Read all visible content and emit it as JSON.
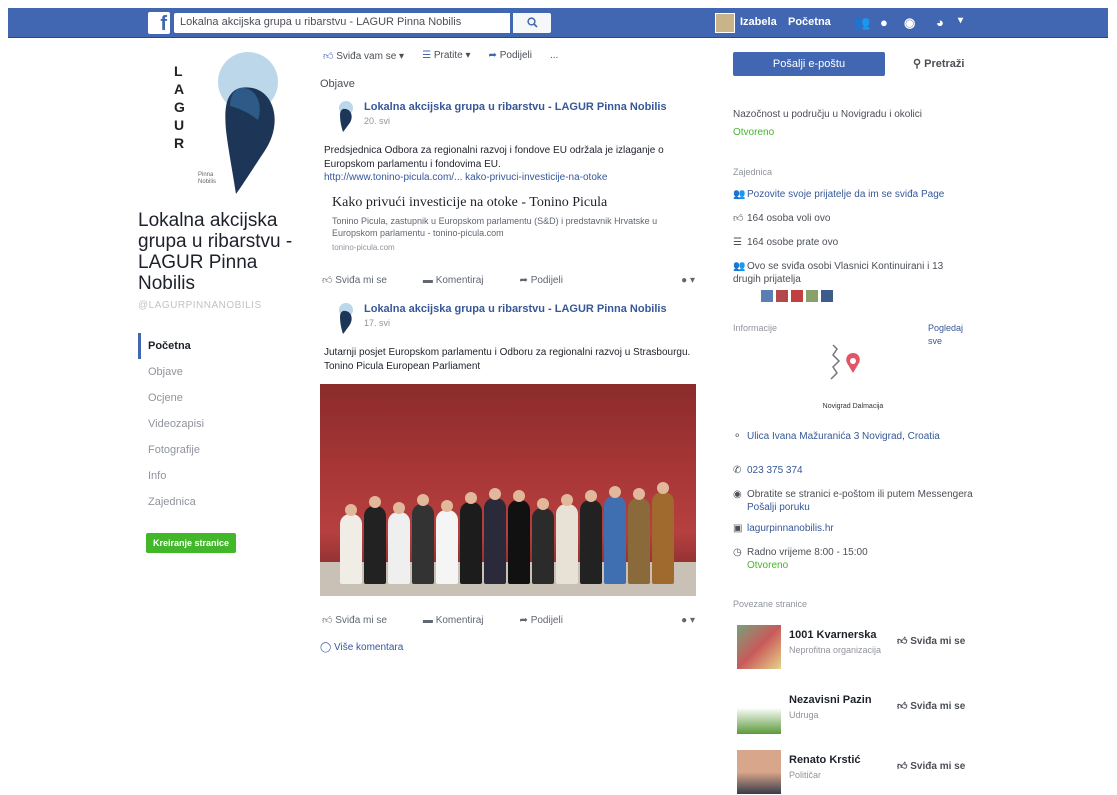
{
  "topbar": {
    "search_value": "Lokalna akcijska grupa u ribarstvu - LAGUR Pinna Nobilis",
    "user_name": "Izabela",
    "home_label": "Početna"
  },
  "left": {
    "logo_letters": [
      "L",
      "A",
      "G",
      "U",
      "R"
    ],
    "logo_caption": "Pinna Nobilis",
    "page_name": "Lokalna akcijska grupa u ribarstvu - LAGUR Pinna Nobilis",
    "handle": "@LAGURPINNANOBILIS",
    "nav": [
      {
        "label": "Početna",
        "active": true
      },
      {
        "label": "Objave"
      },
      {
        "label": "Ocjene"
      },
      {
        "label": "Videozapisi"
      },
      {
        "label": "Fotografije"
      },
      {
        "label": "Info"
      },
      {
        "label": "Zajednica"
      }
    ],
    "create_button": "Kreiranje stranice"
  },
  "middle": {
    "page_actions": [
      "Sviđa vam se",
      "Pratite",
      "Podijeli",
      "..."
    ],
    "section_title": "Objave",
    "posts": [
      {
        "author": "Lokalna akcijska grupa u ribarstvu - LAGUR Pinna Nobilis",
        "time": "20. svi",
        "text": "Predsjednica Odbora za regionalni razvoj i fondove EU održala je izlaganje o Europskom parlamentu i fondovima EU.",
        "link_url": "http://www.tonino-picula.com/... kako-privuci-investicije-na-otoke",
        "link_title": "Kako privući investicije na otoke - Tonino Picula",
        "link_desc": "Tonino Picula, zastupnik u Europskom parlamentu (S&D) i predstavnik Hrvatske u Europskom parlamentu - tonino-picula.com",
        "link_domain": "tonino-picula.com",
        "actions": [
          "Sviđa mi se",
          "Komentiraj",
          "Podijeli"
        ]
      },
      {
        "author": "Lokalna akcijska grupa u ribarstvu - LAGUR Pinna Nobilis",
        "time": "17. svi",
        "text": "Jutarnji posjet Europskom parlamentu i Odboru za regionalni razvoj u Strasbourgu. Tonino Picula European Parliament",
        "actions": [
          "Sviđa mi se",
          "Komentiraj",
          "Podijeli"
        ]
      }
    ],
    "more_comments": "Više komentara"
  },
  "right": {
    "send_button": "Pošalji e-poštu",
    "search_label": "Pretraži",
    "about_line": "Nazočnost u području u Novigradu i okolici",
    "about_link": "Otvoreno",
    "community_head": "Zajednica",
    "community_items": [
      "Pozovite svoje prijatelje da im se sviđa Page",
      "164 osoba voli ovo",
      "164 osobe prate ovo",
      "Ovo se sviđa osobi Vlasnici Kontinuirani i 13 drugih prijatelja"
    ],
    "info_head": "Informacije",
    "info_link": "Pogledaj sve",
    "map_label": "Novigrad Dalmacija",
    "address": "Ulica Ivana Mažuranića 3 Novigrad, Croatia",
    "phone": "023 375 374",
    "message_text": "Obratite se stranici e-poštom ili putem Messengera",
    "send_message": "Pošalji poruku",
    "web": "lagurpinnanobilis.hr",
    "hours": "Radno vrijeme 8:00 - 15:00",
    "hours_status": "Otvoreno",
    "related_head": "Povezane stranice",
    "related": [
      {
        "name": "1001 Kvarnerska",
        "sub": "Neprofitna organizacija"
      },
      {
        "name": "Nezavisni Pazin",
        "sub": "Udruga"
      },
      {
        "name": "Renato Krstić",
        "sub": "Političar"
      }
    ],
    "like_label": "Sviđa mi se"
  },
  "colors": {
    "brand": "#4267b2",
    "link": "#365899",
    "green": "#42b72a"
  },
  "icons": [
    "facebook-logo",
    "search-icon",
    "friends-icon",
    "messages-icon",
    "notifications-icon",
    "help-icon",
    "thumbs-up-icon",
    "rss-icon",
    "share-icon",
    "comment-icon",
    "map-pin-icon",
    "phone-icon",
    "messenger-icon",
    "globe-icon",
    "clock-icon"
  ]
}
